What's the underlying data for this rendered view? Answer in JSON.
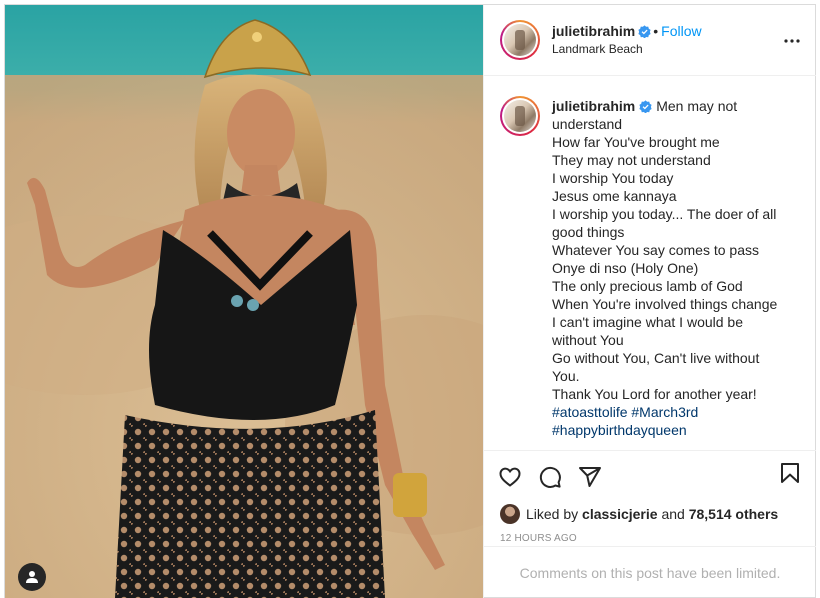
{
  "post": {
    "author": {
      "username": "julietibrahim",
      "verified": true,
      "follow_label": "Follow",
      "separator": "•",
      "location": "Landmark Beach"
    },
    "caption": {
      "username": "julietibrahim",
      "lines": [
        "Men may not",
        "understand",
        "How far You've brought me",
        "They may not understand",
        "I worship You today",
        "Jesus ome kannaya",
        "I worship you today... The doer of all",
        "good things",
        "Whatever You say comes to pass",
        "Onye di nso (Holy One)",
        "The only precious lamb of God",
        "When You're involved things change",
        "I can't imagine what I would be",
        "without You",
        "Go without You, Can't live without",
        "You.",
        "Thank You Lord for another year!"
      ],
      "hashtags": [
        "#atoasttolife",
        "#March3rd",
        "#happybirthdayqueen"
      ]
    },
    "actions": {
      "like_icon": "heart-icon",
      "comment_icon": "comment-icon",
      "share_icon": "paper-plane-icon",
      "save_icon": "bookmark-icon"
    },
    "likes": {
      "prefix": "Liked by",
      "liker": "classicjerie",
      "conjunction": "and",
      "others": "78,514 others"
    },
    "timestamp": "12 HOURS AGO",
    "comments_notice": "Comments on this post have been limited.",
    "colors": {
      "link_blue": "#0095f6",
      "hashtag": "#00376b",
      "verified_badge": "#3897f0",
      "muted": "#8e8e8e"
    }
  }
}
